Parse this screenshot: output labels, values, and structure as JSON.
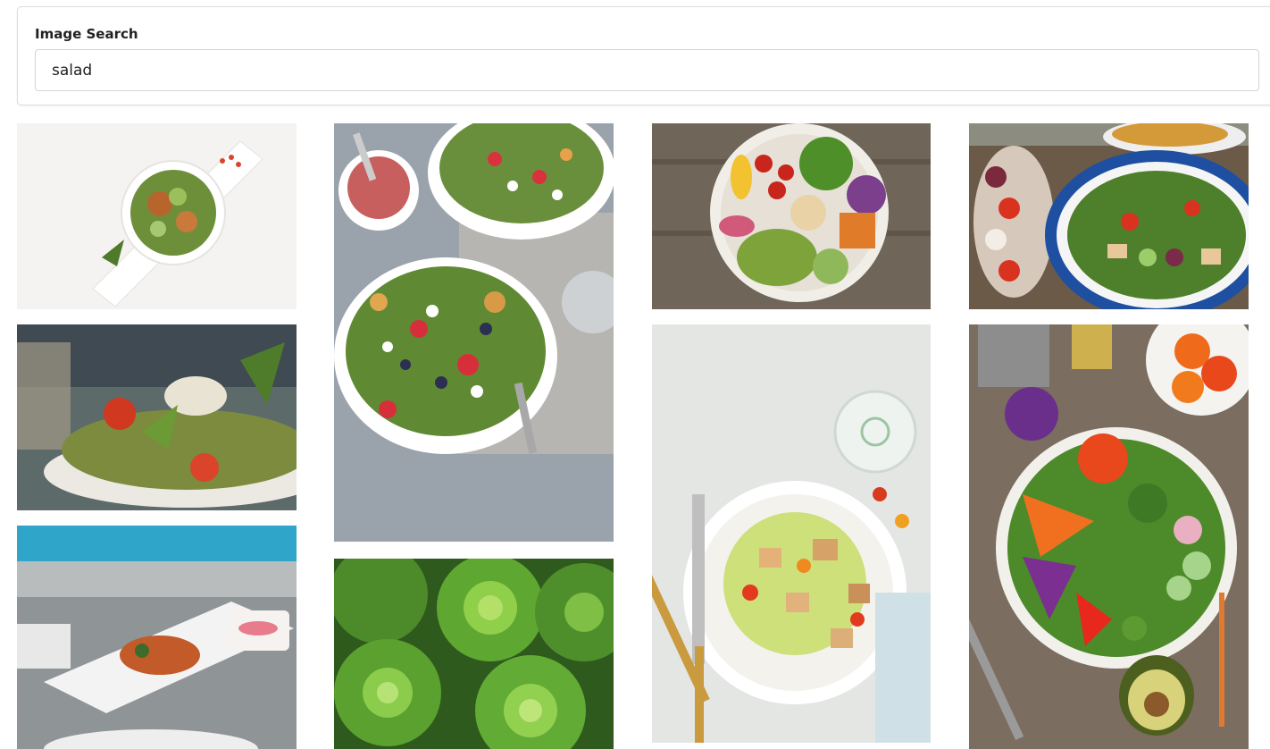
{
  "search": {
    "label": "Image Search",
    "value": "salad"
  },
  "results": [
    {
      "id": "salad-bowl-on-white-board",
      "icon": "image-icon"
    },
    {
      "id": "arugula-salad-side-view",
      "icon": "image-icon"
    },
    {
      "id": "plated-salad-blurred-pool",
      "icon": "image-icon"
    },
    {
      "id": "berry-salad-bowls-with-dressing",
      "icon": "image-icon"
    },
    {
      "id": "butter-lettuce-heads",
      "icon": "image-icon"
    },
    {
      "id": "veggie-buddha-bowl-on-wood",
      "icon": "image-icon"
    },
    {
      "id": "caesar-salad-with-cutlery",
      "icon": "image-icon"
    },
    {
      "id": "blue-striped-bowl-salad",
      "icon": "image-icon"
    },
    {
      "id": "rainbow-salad-with-avocado",
      "icon": "image-icon"
    }
  ],
  "colors": {
    "card_border": "#dcdcdc",
    "input_border": "#d4d4d4",
    "text": "#222222"
  }
}
